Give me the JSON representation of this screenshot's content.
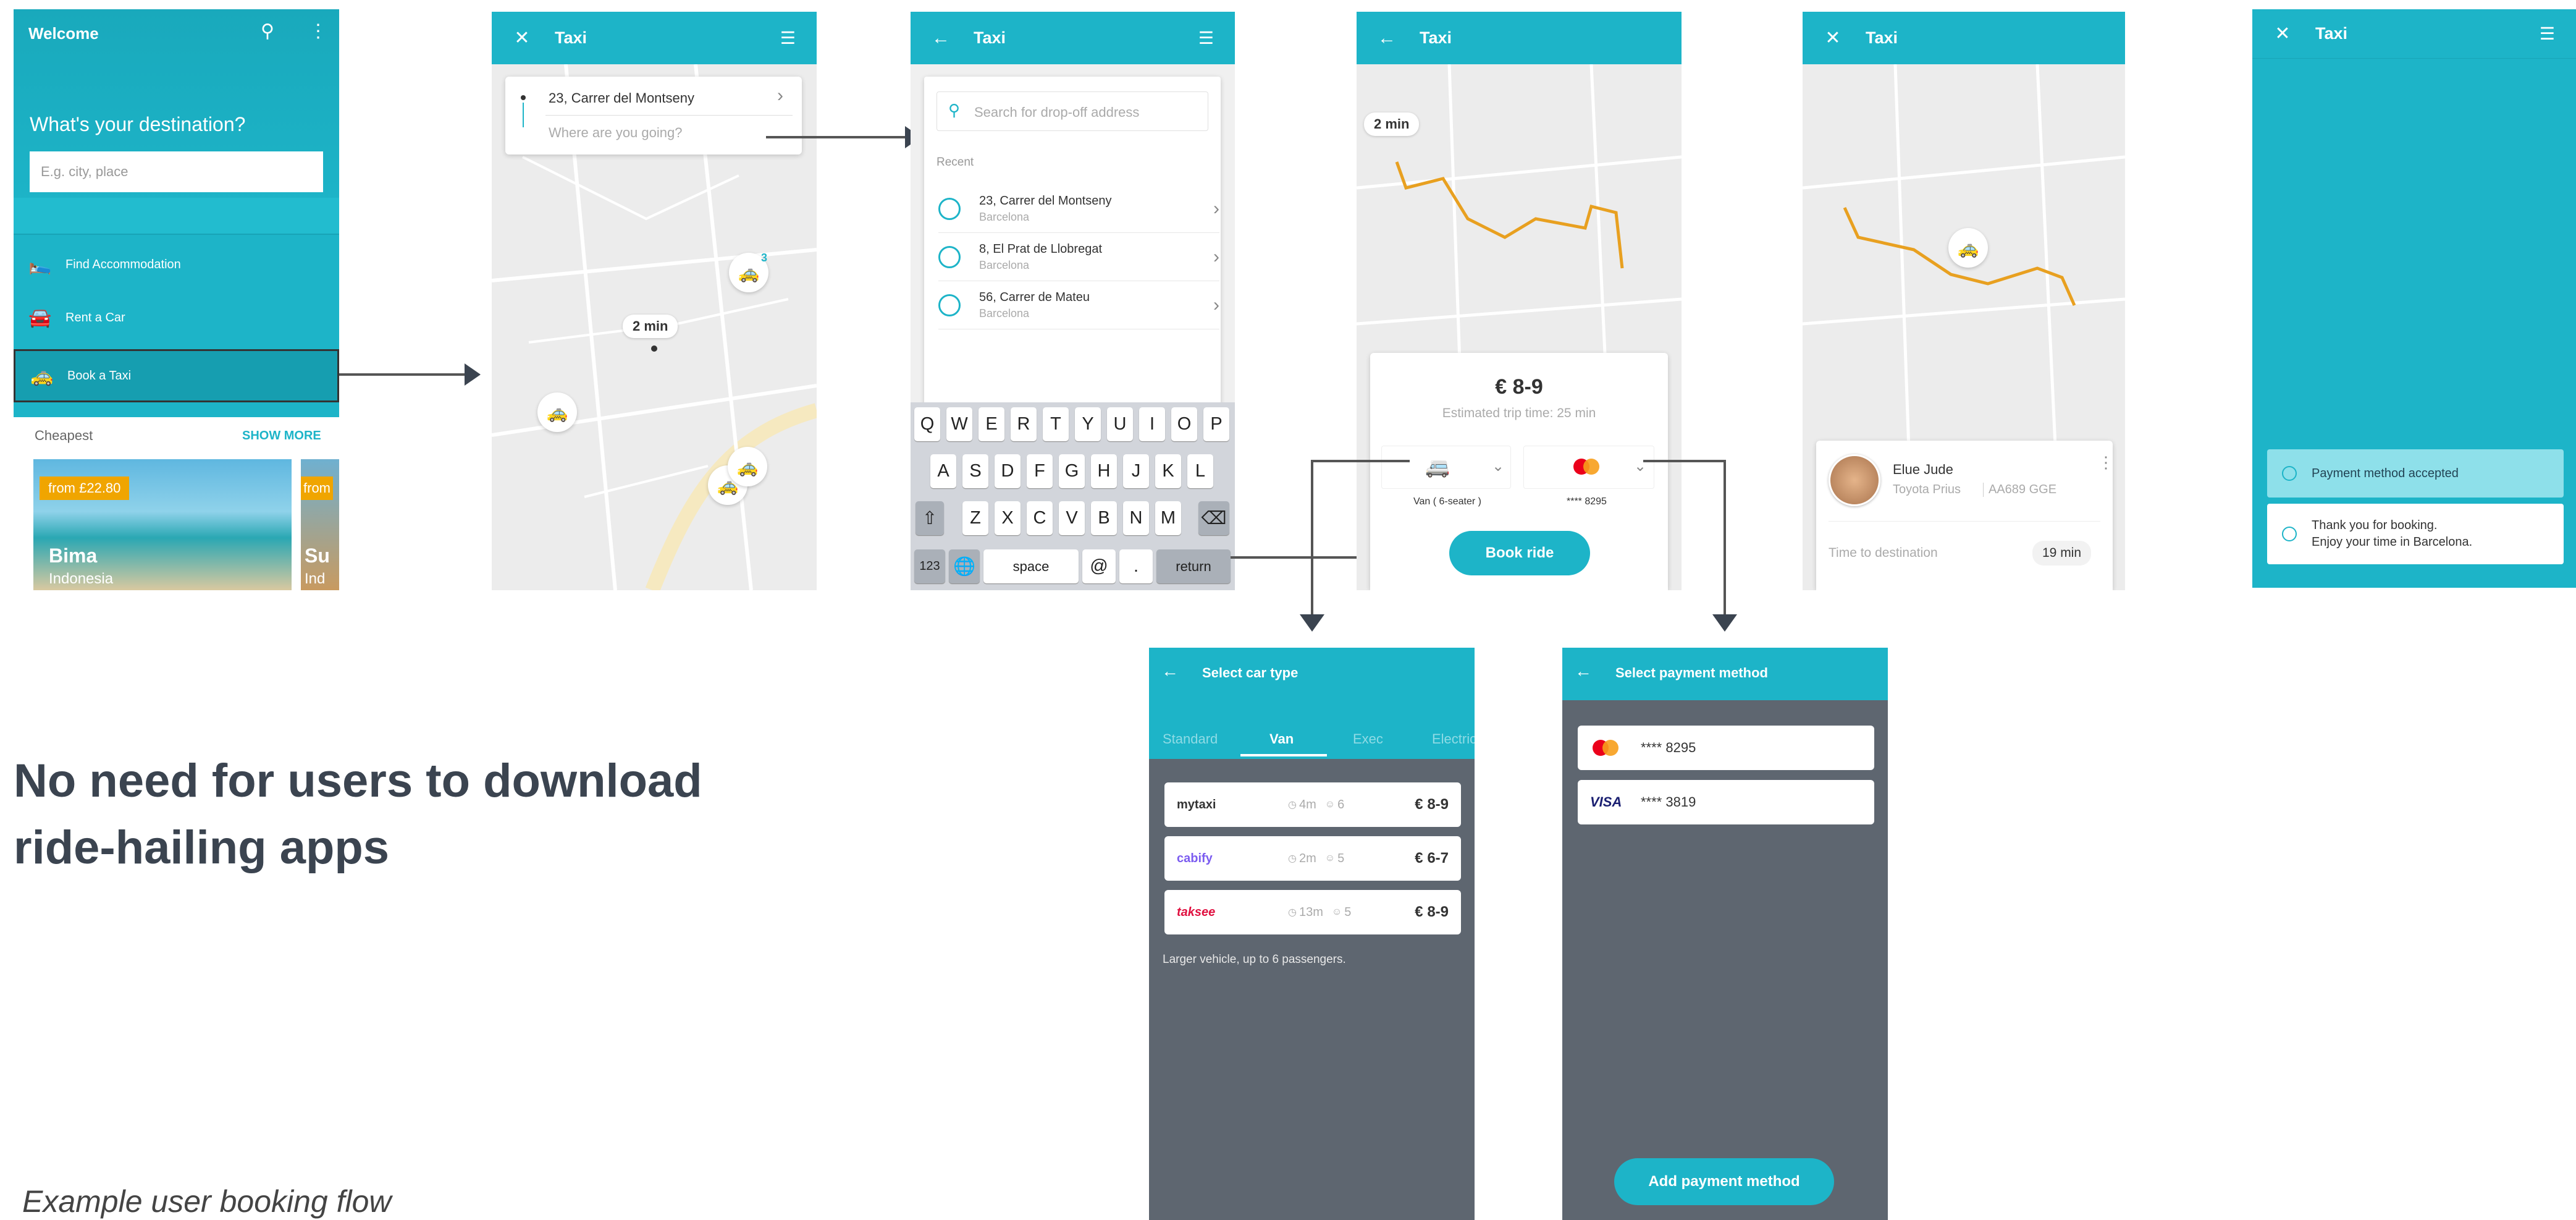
{
  "headline": "No need for users to download ride-hailing apps",
  "caption": "Example user booking flow",
  "s1": {
    "title": "Welcome",
    "question": "What's your destination?",
    "placeholder": "E.g. city, place",
    "menu": [
      "Find Accommodation",
      "Rent a Car",
      "Book a Taxi"
    ],
    "cheapest": "Cheapest",
    "show_more": "SHOW MORE",
    "price": "from £22.80",
    "price2": "from",
    "dest": "Bima",
    "country": "Indonesia",
    "dest2": "Su",
    "country2": "Ind"
  },
  "taxi": "Taxi",
  "s2": {
    "origin": "23, Carrer del Montseny",
    "where": "Where are you going?",
    "eta": "2 min",
    "count": "3"
  },
  "s3": {
    "search": "Search for drop-off address",
    "recent": "Recent",
    "items": [
      {
        "a": "23, Carrer del Montseny",
        "b": "Barcelona"
      },
      {
        "a": "8, El Prat de Llobregat",
        "b": "Barcelona"
      },
      {
        "a": "56, Carrer de Mateu",
        "b": "Barcelona"
      }
    ],
    "keys1": [
      "Q",
      "W",
      "E",
      "R",
      "T",
      "Y",
      "U",
      "I",
      "O",
      "P"
    ],
    "keys2": [
      "A",
      "S",
      "D",
      "F",
      "G",
      "H",
      "J",
      "K",
      "L"
    ],
    "keys3": [
      "Z",
      "X",
      "C",
      "V",
      "B",
      "N",
      "M"
    ],
    "k123": "123",
    "space": "space",
    "at": "@",
    "dot": ".",
    "ret": "return"
  },
  "s4": {
    "eta": "2 min",
    "price": "€ 8-9",
    "trip": "Estimated trip time: 25 min",
    "van": "Van ( 6-seater )",
    "card": "**** 8295",
    "book": "Book ride"
  },
  "s5": {
    "driver": "Elue Jude",
    "car": "Toyota Prius",
    "plate": "AA689 GGE",
    "ttd": "Time to destination",
    "min": "19 min"
  },
  "s6": {
    "msg1": "Payment method accepted",
    "msg2a": "Thank you for booking.",
    "msg2b": "Enjoy your time in Barcelona."
  },
  "s7": {
    "title": "Select car type",
    "tabs": [
      "Standard",
      "Van",
      "Exec",
      "Electric"
    ],
    "opts": [
      {
        "brand": "mytaxi",
        "t": "4m",
        "p": "6",
        "price": "€ 8-9"
      },
      {
        "brand": "cabify",
        "t": "2m",
        "p": "5",
        "price": "€ 6-7"
      },
      {
        "brand": "taksee",
        "t": "13m",
        "p": "5",
        "price": "€ 8-9"
      }
    ],
    "note": "Larger vehicle, up to 6 passengers."
  },
  "s8": {
    "title": "Select payment method",
    "c1": "**** 8295",
    "c2": "**** 3819",
    "visa": "VISA",
    "add": "Add payment method"
  },
  "colors": {
    "accent": "#1db4c8",
    "route": "#e8a020",
    "dark": "#5e6670",
    "headline": "#3b4450"
  }
}
